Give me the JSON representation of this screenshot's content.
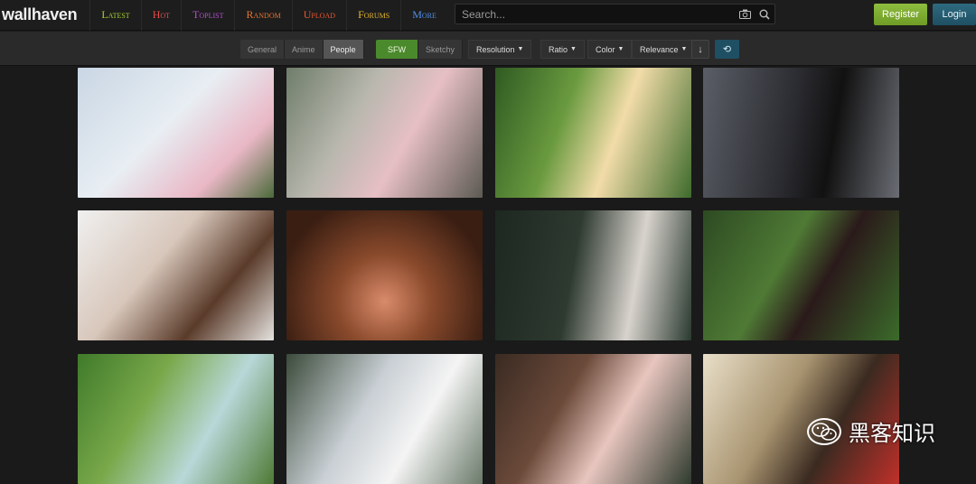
{
  "header": {
    "logo": "wallhaven",
    "nav": [
      {
        "label": "Latest",
        "color": "#a2cf2f"
      },
      {
        "label": "Hot",
        "color": "#e64c4c"
      },
      {
        "label": "Toplist",
        "color": "#b24fcf"
      },
      {
        "label": "Random",
        "color": "#e6732f"
      },
      {
        "label": "Upload",
        "color": "#e6572f"
      },
      {
        "label": "Forums",
        "color": "#e6b82f"
      },
      {
        "label": "More",
        "color": "#4f8fe6"
      }
    ],
    "search_placeholder": "Search...",
    "register_label": "Register",
    "login_label": "Login"
  },
  "filters": {
    "categories": [
      "General",
      "Anime",
      "People"
    ],
    "active_category": "People",
    "purity": [
      "SFW",
      "Sketchy"
    ],
    "active_purity": "SFW",
    "dropdowns": [
      "Resolution",
      "Ratio",
      "Color",
      "Relevance"
    ]
  },
  "watermark": "黑客知识"
}
